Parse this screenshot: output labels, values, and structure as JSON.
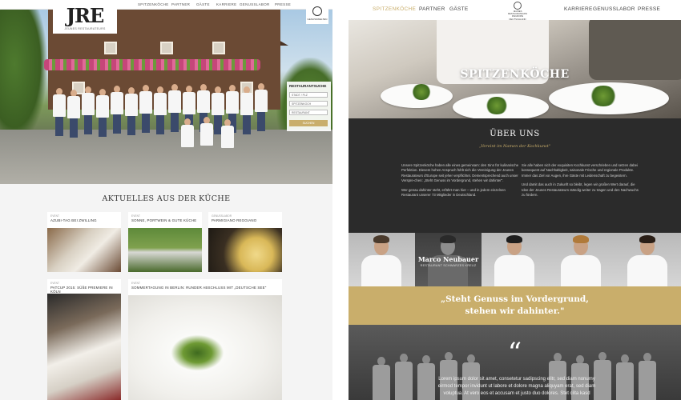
{
  "left": {
    "nav": [
      "SPITZENKÖCHE",
      "PARTNER",
      "GÄSTE",
      "KARRIERE",
      "GENUSSLABOR",
      "PRESSE"
    ],
    "logo": {
      "mark": "JRE",
      "sub": "JEUNES RESTAURATEURS"
    },
    "seal": "GENUSSWELTEN",
    "search": {
      "title": "RESTAURANTSUCHE",
      "fields": [
        "STADT / PLZ",
        "SPITZENKOCH",
        "RESTAURANT"
      ],
      "button": "SUCHEN"
    },
    "section_title": "AKTUELLES AUS DER KÜCHE",
    "cards": [
      {
        "cat": "EVENT",
        "title": "AZUBI-TAG BEI ZWILLING"
      },
      {
        "cat": "EVENT",
        "title": "SONNE, PORTWEIN & GUTE KÜCHE"
      },
      {
        "cat": "GENUSSLABOR",
        "title": "PARMIGIANO REGGIANO"
      },
      {
        "cat": "EVENT",
        "title": "PATCUP 2015: SÜßE PREMIERE IN KÖLN"
      },
      {
        "cat": "EVENT",
        "title": "SOMMERTAGUNG IN BERLIN: RUNDER ABSCHLUSS MIT „DEUTSCHE SEE\""
      }
    ]
  },
  "right": {
    "nav": {
      "left": [
        "SPITZENKÖCHE",
        "PARTNER",
        "GÄSTE"
      ],
      "right": [
        "KARRIERE",
        "GENUSSLABOR",
        "PRESSE"
      ],
      "logo_text": "JEUNES RESTAURATEURS D'EUROPE DEUTSCHLAND"
    },
    "hero_title": "SPITZENKÖCHE",
    "about": {
      "title": "ÜBER UNS",
      "quote": "„Vereint im Namen der Kochkunst\"",
      "col1": [
        "Unsere Spitzenköche haben alle eines gemeinsam: den Sinn für kulinarische Perfektion. Diesem hohen Anspruch fühlt sich die Vereinigung der Jeunes Restaurateurs d'Europe seit jeher verpflichtet. Dementsprechend auch unser Verspre-chen: „Steht Genuss im Vordergrund, stehen wir dahinter\".",
        "Wer genau dahinter steht, erfährt man hier – und in jedem einzelnen Restaurant unserer 73 Mitglieder in Deutschland."
      ],
      "col2": [
        "Sie alle haben sich der exquisiten Kochkunst verschrieben und setzen dabei konsequent auf Nachhaltigkeit, saisonale Frische und regionale Produkte. Immer das Ziel vor Augen, ihre Gäste mit Leidenschaft zu begeistern.",
        "Und damit das auch in Zukunft so bleibt, legen wir großen Wert darauf, die Idee der Jeunes Restaurateurs ständig weiter zu tragen und den Nachwuchs zu fördern."
      ]
    },
    "featured_chef": {
      "name": "Marco Neubauer",
      "restaurant": "RESTAURANT SCHWARZES KREUZ"
    },
    "quote_band": [
      "„Steht Genuss im Vordergrund,",
      "stehen wir dahinter.\""
    ],
    "bottom": {
      "quote_mark": "“",
      "text1": "Lorem ipsum dolor sit amet, consetetur sadipscing elitr, sed diam nonumy",
      "text2": "eirmod tempor invidunt ut labore et dolore magna aliquyam erat, sed diam",
      "text3": "voluptua. At vero eos et accusam et justo duo dolores. Stet clita kasd"
    }
  }
}
